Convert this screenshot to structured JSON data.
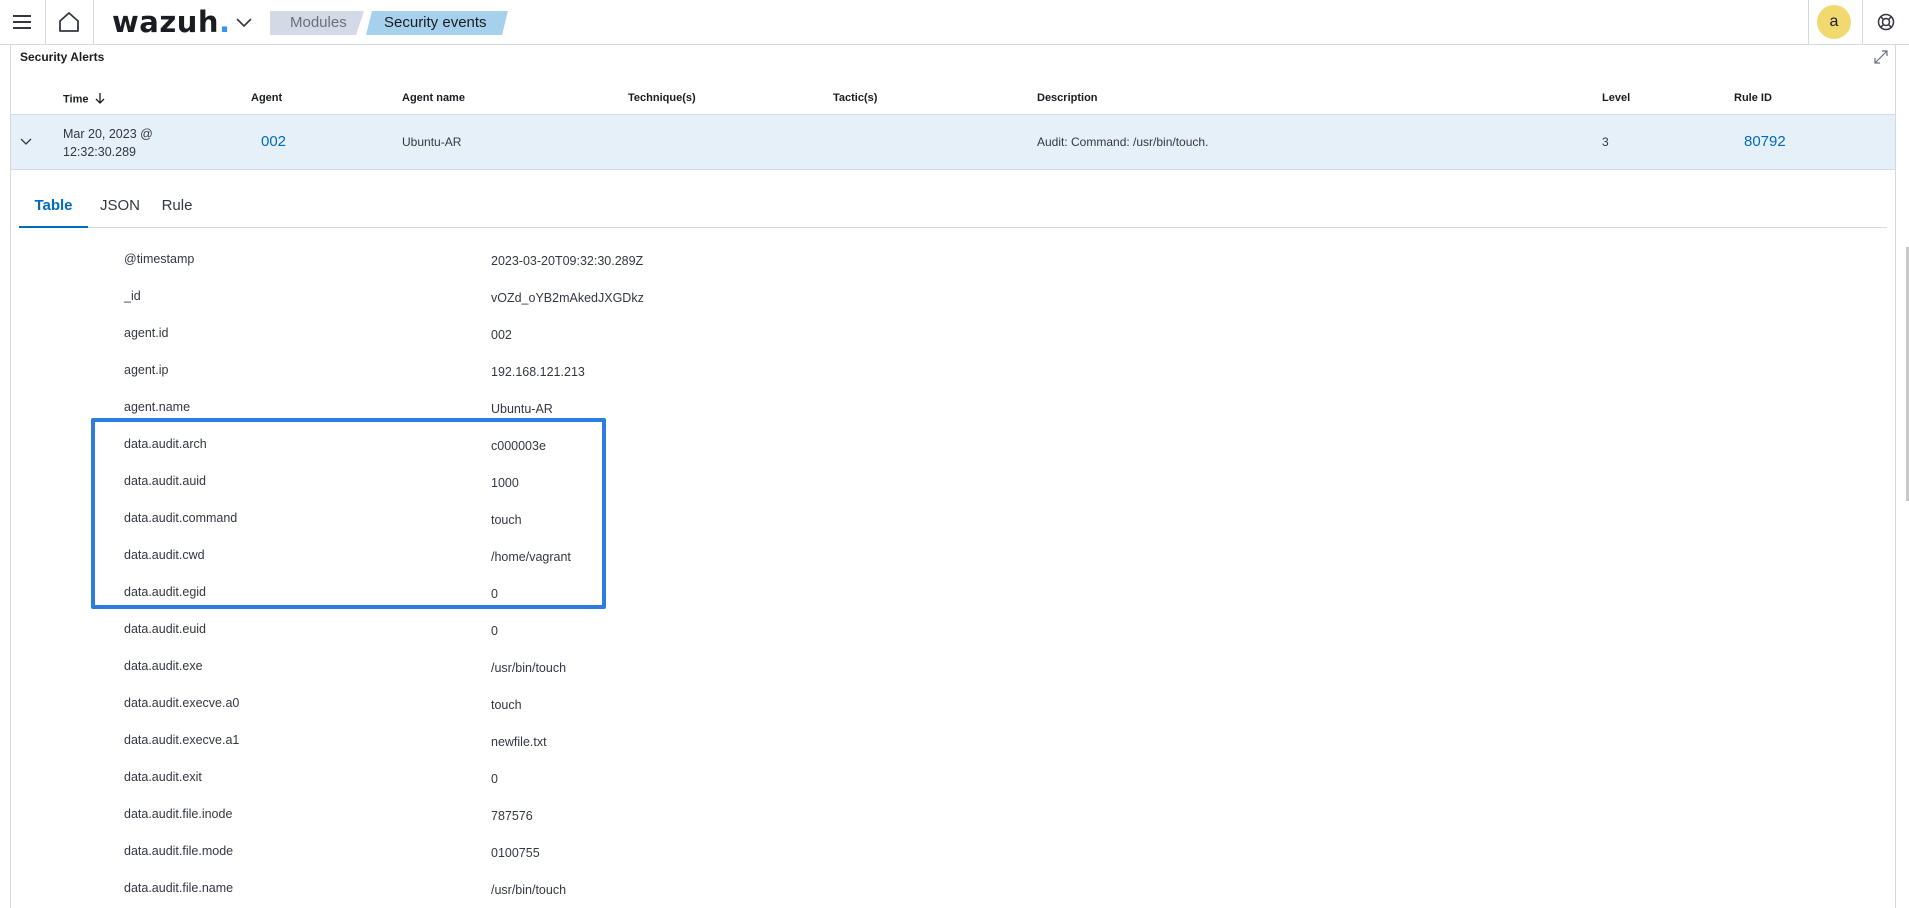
{
  "topbar": {
    "logo_text": "wazuh",
    "logo_dot": ".",
    "breadcrumbs": [
      "Modules",
      "Security events"
    ],
    "avatar_letter": "a"
  },
  "panel": {
    "title": "Security Alerts"
  },
  "table": {
    "headers": {
      "time": "Time",
      "agent": "Agent",
      "agent_name": "Agent name",
      "techniques": "Technique(s)",
      "tactics": "Tactic(s)",
      "description": "Description",
      "level": "Level",
      "rule_id": "Rule ID"
    },
    "time_sort_icon": "arrow-down-icon",
    "row": {
      "time_line1": "Mar 20, 2023 @",
      "time_line2": "12:32:30.289",
      "agent": "002",
      "agent_name": "Ubuntu-AR",
      "techniques": "",
      "tactics": "",
      "description": "Audit: Command: /usr/bin/touch.",
      "level": "3",
      "rule_id": "80792"
    }
  },
  "detail_tabs": [
    "Table",
    "JSON",
    "Rule"
  ],
  "active_tab": "Table",
  "fields": [
    {
      "name": "@timestamp",
      "value": "2023-03-20T09:32:30.289Z"
    },
    {
      "name": "_id",
      "value": "vOZd_oYB2mAkedJXGDkz"
    },
    {
      "name": "agent.id",
      "value": "002"
    },
    {
      "name": "agent.ip",
      "value": "192.168.121.213"
    },
    {
      "name": "agent.name",
      "value": "Ubuntu-AR"
    },
    {
      "name": "data.audit.arch",
      "value": "c000003e"
    },
    {
      "name": "data.audit.auid",
      "value": "1000"
    },
    {
      "name": "data.audit.command",
      "value": "touch"
    },
    {
      "name": "data.audit.cwd",
      "value": "/home/vagrant"
    },
    {
      "name": "data.audit.egid",
      "value": "0"
    },
    {
      "name": "data.audit.euid",
      "value": "0"
    },
    {
      "name": "data.audit.exe",
      "value": "/usr/bin/touch"
    },
    {
      "name": "data.audit.execve.a0",
      "value": "touch"
    },
    {
      "name": "data.audit.execve.a1",
      "value": "newfile.txt"
    },
    {
      "name": "data.audit.exit",
      "value": "0"
    },
    {
      "name": "data.audit.file.inode",
      "value": "787576"
    },
    {
      "name": "data.audit.file.mode",
      "value": "0100755"
    },
    {
      "name": "data.audit.file.name",
      "value": "/usr/bin/touch"
    }
  ],
  "colors": {
    "accent": "#006bb8",
    "highlight_box": "#2d7de0",
    "row_selected": "#e6f0f8",
    "avatar": "#f1d86f"
  }
}
